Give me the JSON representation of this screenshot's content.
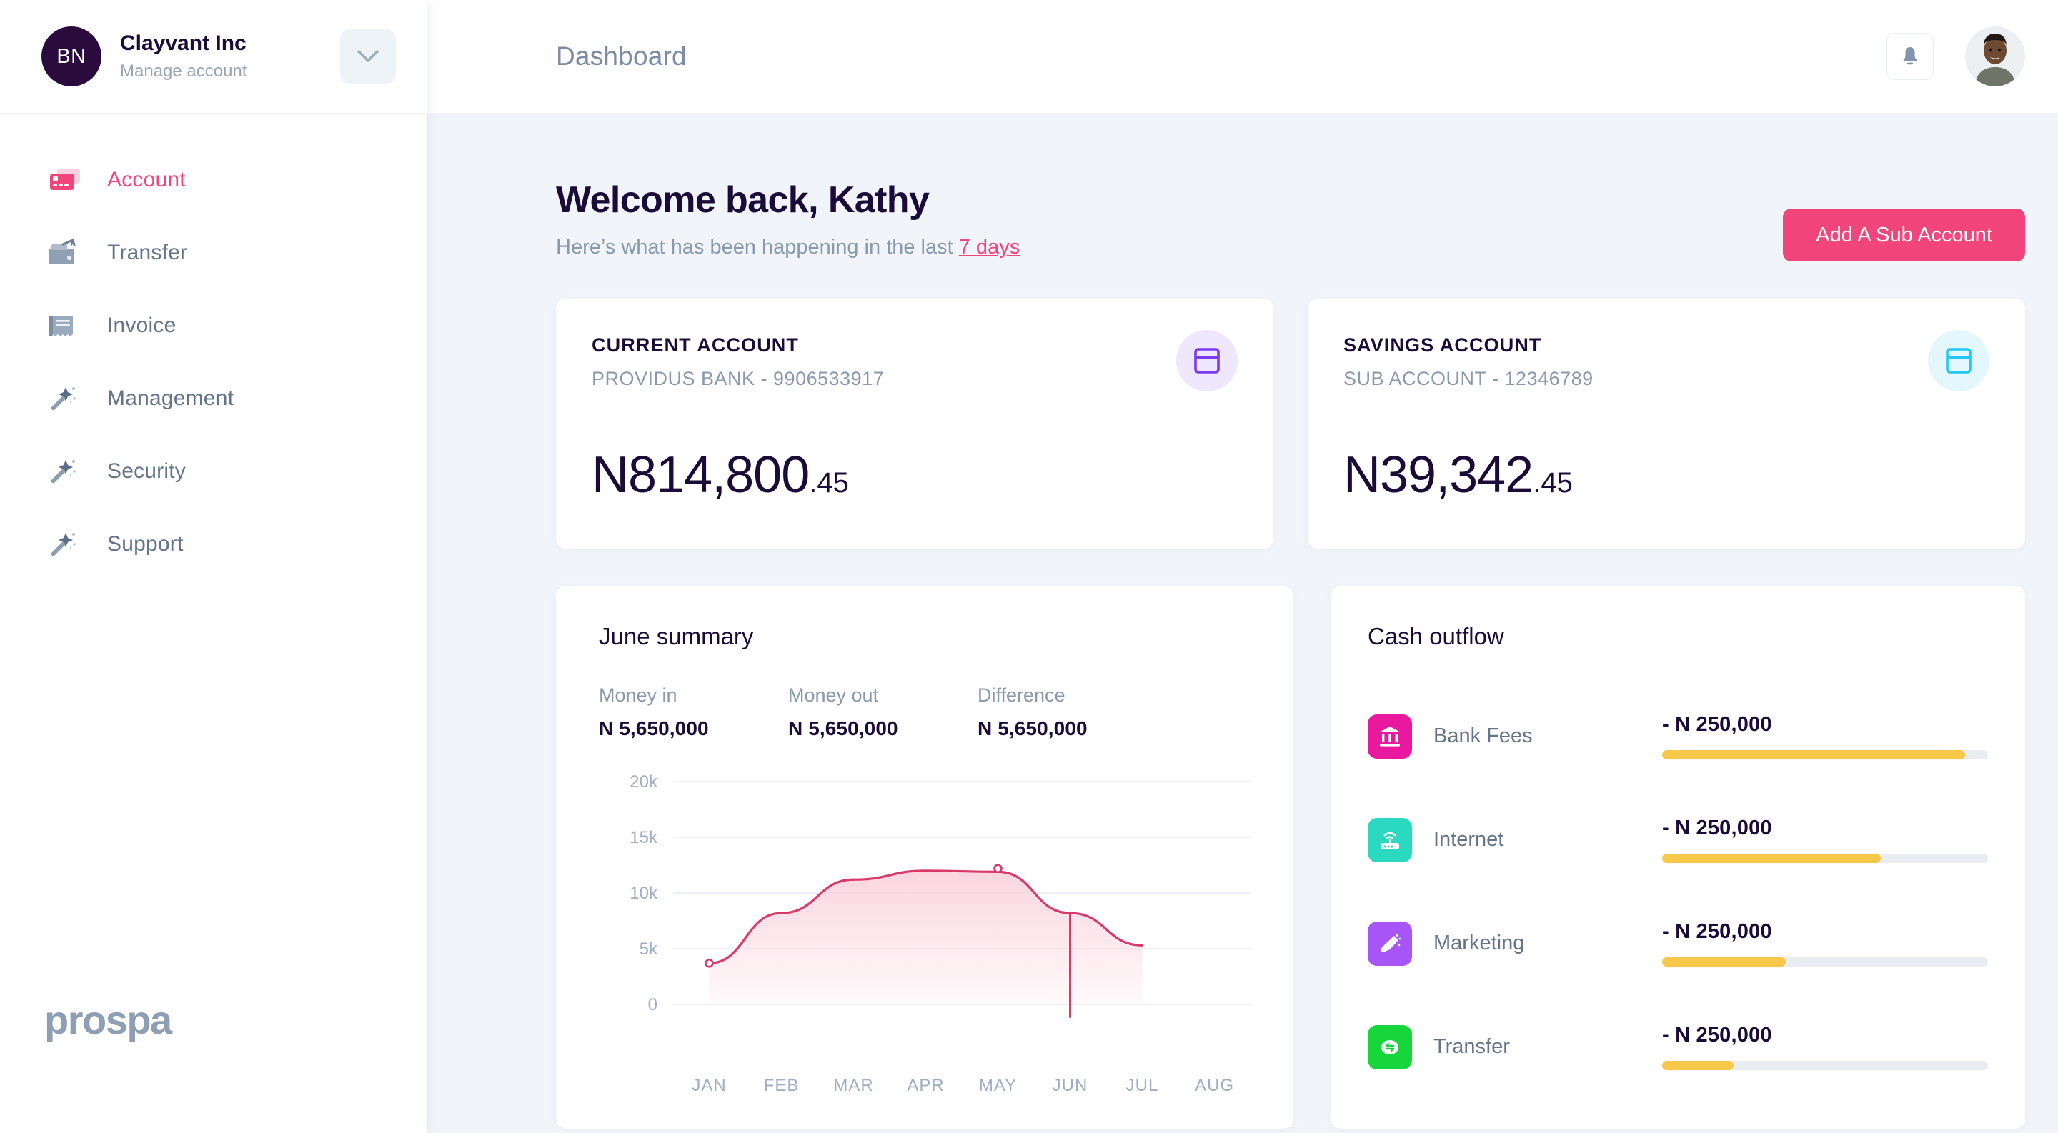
{
  "sidebar": {
    "org": {
      "initials": "BN",
      "name": "Clayvant Inc",
      "subtitle": "Manage account"
    },
    "chevron_icon": "chevron-down-icon",
    "items": [
      {
        "label": "Account",
        "icon": "credit-card-icon",
        "active": true
      },
      {
        "label": "Transfer",
        "icon": "wallet-arrow-icon",
        "active": false
      },
      {
        "label": "Invoice",
        "icon": "receipt-icon",
        "active": false
      },
      {
        "label": "Management",
        "icon": "magic-wand-icon",
        "active": false
      },
      {
        "label": "Security",
        "icon": "magic-wand-icon",
        "active": false
      },
      {
        "label": "Support",
        "icon": "magic-wand-icon",
        "active": false
      }
    ],
    "brand": "prospa"
  },
  "topbar": {
    "title": "Dashboard",
    "bell_icon": "bell-icon",
    "avatar_icon": "user-avatar"
  },
  "welcome": {
    "title": "Welcome back, Kathy",
    "subtitle_prefix": "Here’s what has been happening in the last ",
    "subtitle_link": "7 days",
    "cta_label": "Add A Sub Account"
  },
  "accounts": [
    {
      "label": "CURRENT ACCOUNT",
      "meta": "PROVIDUS BANK - 9906533917",
      "amount_main": "N814,800",
      "amount_cents": ".45",
      "icon": "card-icon",
      "icon_color": "#7C3AED",
      "icon_bg": "#EFE7FE"
    },
    {
      "label": "SAVINGS ACCOUNT",
      "meta": "SUB ACCOUNT - 12346789",
      "amount_main": "N39,342",
      "amount_cents": ".45",
      "icon": "card-icon",
      "icon_color": "#22C7F2",
      "icon_bg": "#E4F7FE"
    }
  ],
  "summary": {
    "title": "June summary",
    "stats": [
      {
        "label": "Money in",
        "value": "N 5,650,000"
      },
      {
        "label": "Money out",
        "value": "N 5,650,000"
      },
      {
        "label": "Difference",
        "value": "N 5,650,000"
      }
    ]
  },
  "chart_data": {
    "type": "area",
    "title": "June summary",
    "x": [
      "JAN",
      "FEB",
      "MAR",
      "APR",
      "MAY",
      "JUN",
      "JUL",
      "AUG"
    ],
    "categories": [
      "JAN",
      "FEB",
      "MAR",
      "APR",
      "MAY",
      "JUN",
      "JUL",
      "AUG"
    ],
    "values": [
      3700,
      8200,
      11200,
      12000,
      11900,
      8200,
      5300,
      null
    ],
    "series": [
      {
        "name": "Cash flow",
        "values": [
          3700,
          8200,
          11200,
          12000,
          11900,
          8200,
          5300,
          null
        ]
      }
    ],
    "ylim": [
      0,
      20000
    ],
    "ytick_labels": [
      "0",
      "5k",
      "10k",
      "15k",
      "20k"
    ],
    "ytick_values": [
      0,
      5000,
      10000,
      15000,
      20000
    ],
    "xlabel": "",
    "ylabel": "",
    "grid": true,
    "legend": "none",
    "line_color": "#D93A6B",
    "fill_color": "#FBD3DE",
    "markers": [
      {
        "x": "JAN",
        "y": 3700
      },
      {
        "x": "MAY",
        "y": 12200
      }
    ],
    "vertical_marker": {
      "x": "JUN",
      "y_top": 8200,
      "y_bottom": -1200
    }
  },
  "outflow": {
    "title": "Cash outflow",
    "rows": [
      {
        "name": "Bank Fees",
        "amount": "- N 250,000",
        "percent": 93,
        "icon": "bank-icon",
        "icon_bg": "#E9189E"
      },
      {
        "name": "Internet",
        "amount": "- N 250,000",
        "percent": 67,
        "icon": "router-icon",
        "icon_bg": "#2BD9C0"
      },
      {
        "name": "Marketing",
        "amount": "- N 250,000",
        "percent": 38,
        "icon": "megaphone-icon",
        "icon_bg": "#A855F7"
      },
      {
        "name": "Transfer",
        "amount": "- N 250,000",
        "percent": 22,
        "icon": "exchange-icon",
        "icon_bg": "#17D63C"
      }
    ],
    "bar_color": "#F8C84A",
    "bar_track_color": "#E9EDF2"
  },
  "theme": {
    "accent_pink": "#F2457B",
    "ink": "#1B0B38",
    "muted": "#8A99AE",
    "page_bg": "#F1F5F9"
  }
}
